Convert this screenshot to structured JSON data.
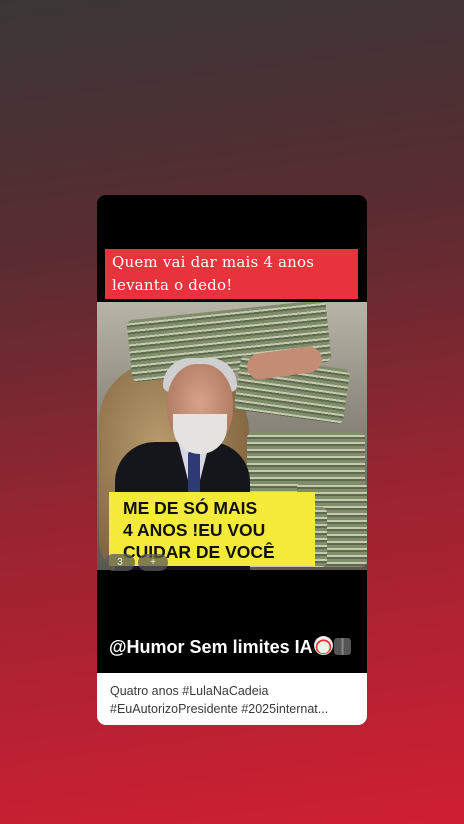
{
  "card": {
    "top_caption": "Quem vai dar mais 4 anos levanta o dedo!",
    "image_text": "ME DE SÓ  MAIS\n4 ANOS !EU VOU\nCUIDAR DE VOCÊ",
    "badges": [
      "3",
      "+"
    ],
    "watermark": "@Humor Sem limites IA",
    "watermark_icons": [
      "clown-face-icon",
      "film-icon"
    ],
    "description_line1": "Quatro anos #LulaNaCadeia",
    "description_line2": "#EuAutorizoPresidente #2025internat..."
  },
  "colors": {
    "caption_bg": "#e8323c",
    "image_text_bg": "#f3ea3a",
    "background_bottom": "#cf1f33",
    "background_top": "#3a3637"
  }
}
